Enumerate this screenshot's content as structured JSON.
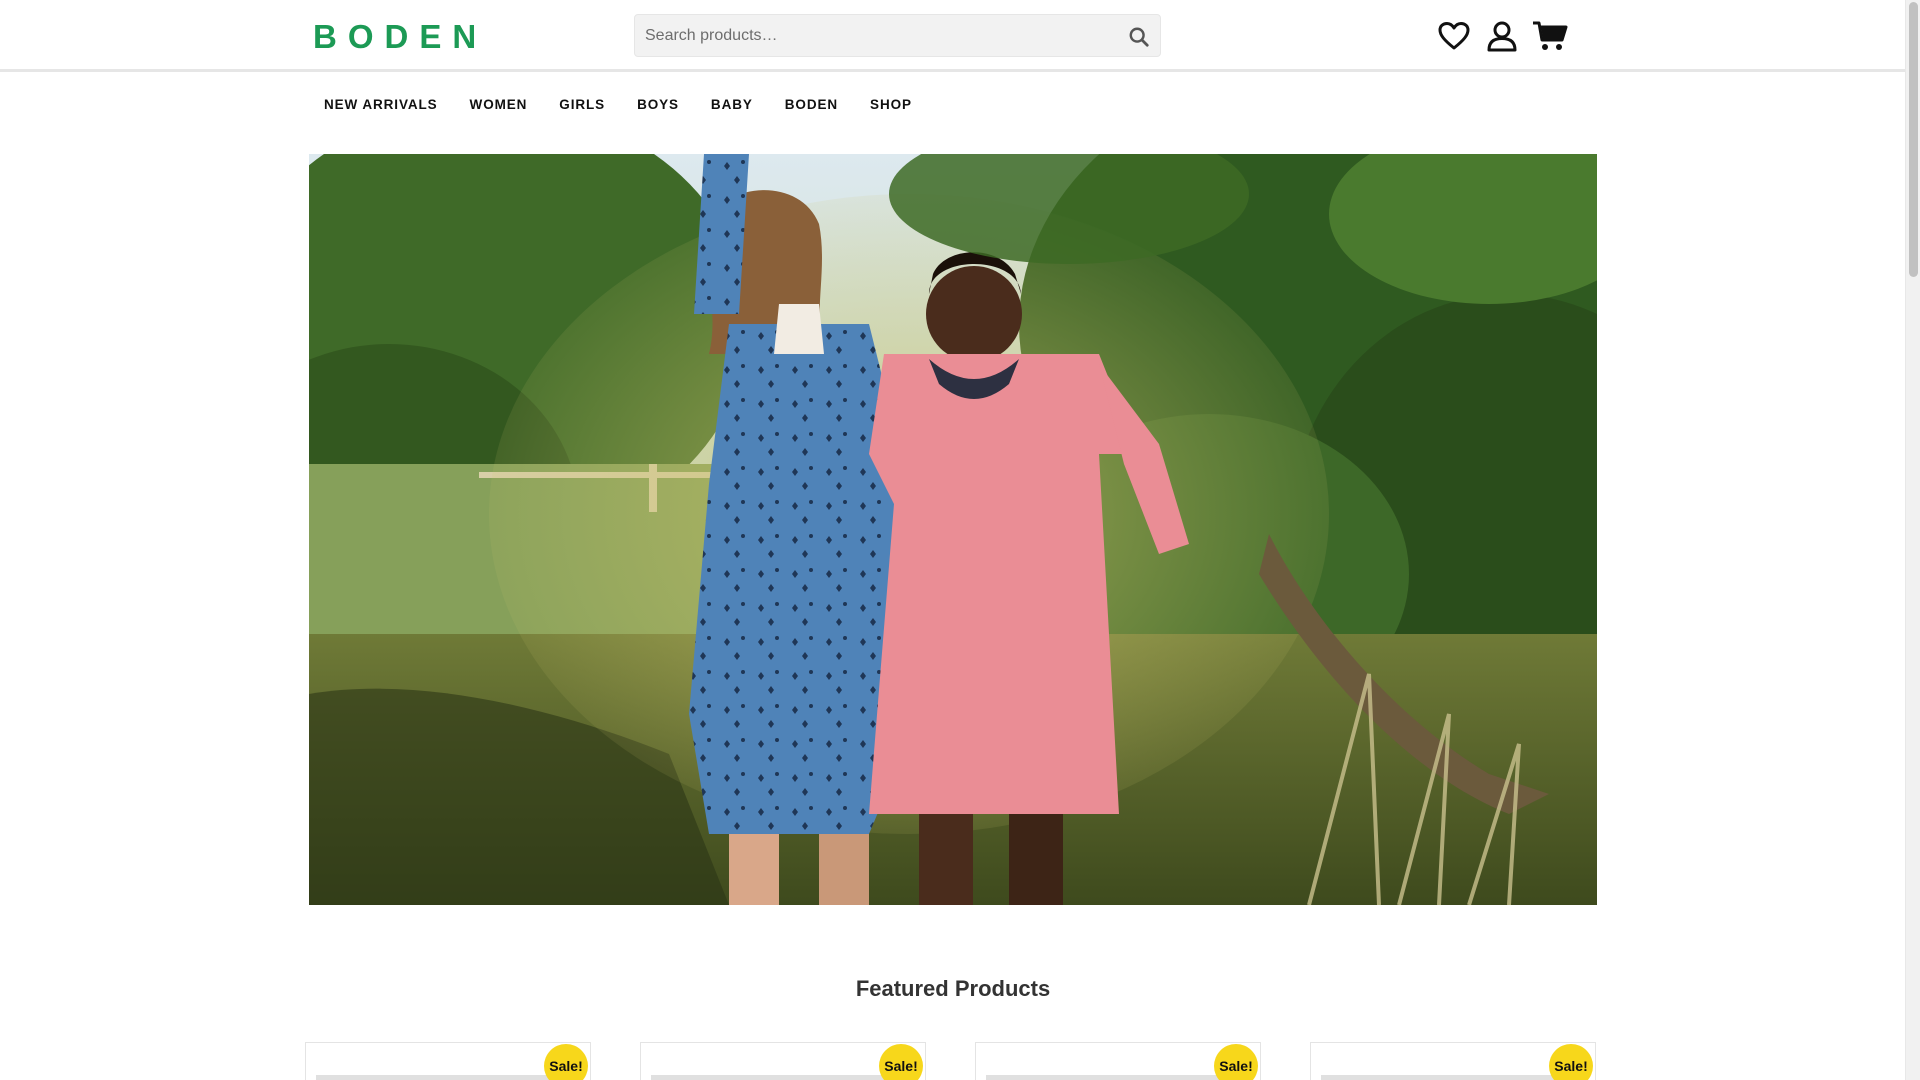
{
  "brand": {
    "name": "BODEN",
    "color": "#1c9a55"
  },
  "search": {
    "placeholder": "Search products…"
  },
  "header_icons": [
    "wishlist-heart-icon",
    "account-user-icon",
    "cart-icon"
  ],
  "nav": {
    "items": [
      {
        "label": "NEW ARRIVALS"
      },
      {
        "label": "WOMEN"
      },
      {
        "label": "GIRLS"
      },
      {
        "label": "BOYS"
      },
      {
        "label": "BABY"
      },
      {
        "label": "BODEN"
      },
      {
        "label": "SHOP"
      }
    ]
  },
  "featured": {
    "title": "Featured Products",
    "products": [
      {
        "badge": "Sale!"
      },
      {
        "badge": "Sale!"
      },
      {
        "badge": "Sale!"
      },
      {
        "badge": "Sale!"
      }
    ]
  },
  "colors": {
    "sale_badge": "#f7d71b",
    "nav_text": "#111111",
    "header_border": "#e6e6e6"
  }
}
